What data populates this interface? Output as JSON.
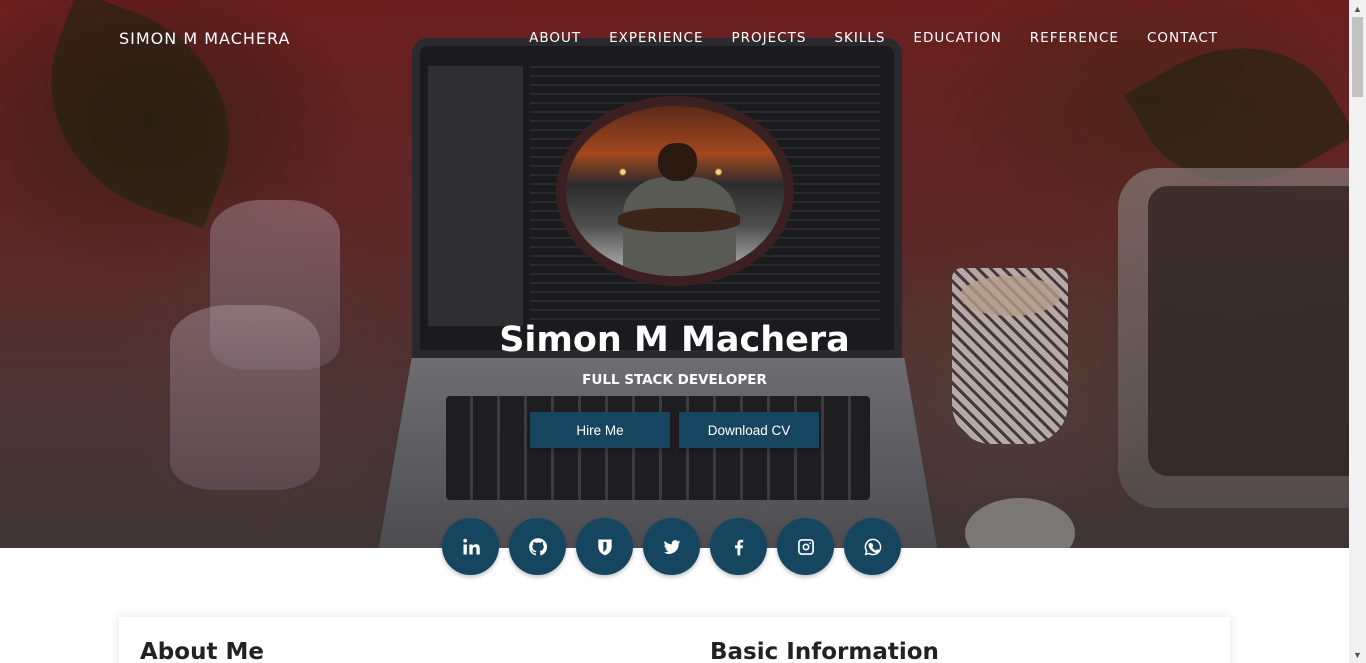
{
  "brand": "SIMON M MACHERA",
  "nav": [
    "ABOUT",
    "EXPERIENCE",
    "PROJECTS",
    "SKILLS",
    "EDUCATION",
    "REFERENCE",
    "CONTACT"
  ],
  "hero": {
    "name": "Simon M Machera",
    "title": "FULL STACK DEVELOPER",
    "hire_label": "Hire Me",
    "cv_label": "Download CV"
  },
  "socials": [
    "linkedin-icon",
    "github-icon",
    "shield-icon",
    "twitter-icon",
    "facebook-icon",
    "instagram-icon",
    "whatsapp-icon"
  ],
  "sections": {
    "about": "About Me",
    "basic": "Basic Information"
  },
  "colors": {
    "accent": "#16465f",
    "overlay": "#6b1f1f"
  }
}
